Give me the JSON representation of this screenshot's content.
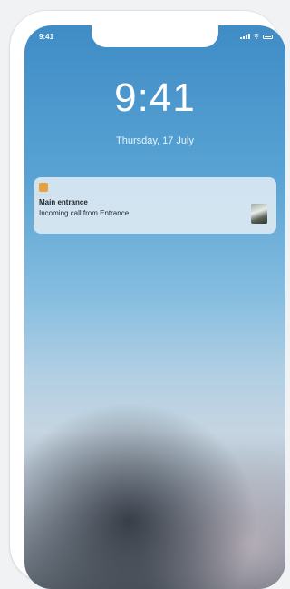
{
  "status_bar": {
    "time": "9:41"
  },
  "lock_screen": {
    "time": "9:41",
    "date": "Thursday, 17 July"
  },
  "notification": {
    "app_icon": "app-icon",
    "title": "Main entrance",
    "body": "Incoming call from Entrance",
    "accent_color": "#e9a13b"
  },
  "colors": {
    "wallpaper_top": "#3f8cc6",
    "wallpaper_bottom": "#5c646e",
    "text": "#ffffff"
  }
}
